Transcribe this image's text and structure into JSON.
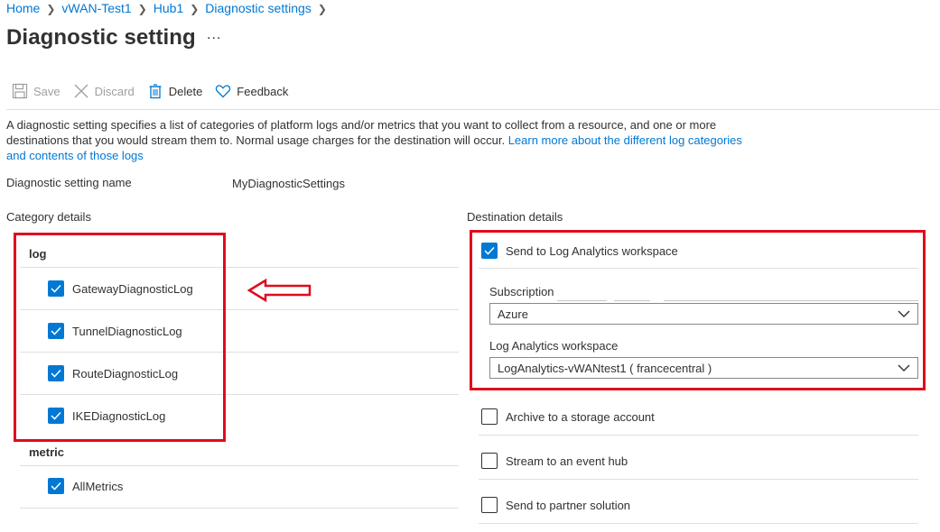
{
  "breadcrumb": [
    "Home",
    "vWAN-Test1",
    "Hub1",
    "Diagnostic settings"
  ],
  "page_title": "Diagnostic setting",
  "more_label": "...",
  "toolbar": {
    "save": "Save",
    "discard": "Discard",
    "delete": "Delete",
    "feedback": "Feedback"
  },
  "description": {
    "text": "A diagnostic setting specifies a list of categories of platform logs and/or metrics that you want to collect from a resource, and one or more destinations that you would stream them to. Normal usage charges for the destination will occur.",
    "link": "Learn more about the different log categories and contents of those logs"
  },
  "setting_name": {
    "label": "Diagnostic setting name",
    "value": "MyDiagnosticSettings"
  },
  "category_details": {
    "header": "Category details",
    "log_title": "log",
    "logs": [
      {
        "label": "GatewayDiagnosticLog",
        "checked": true
      },
      {
        "label": "TunnelDiagnosticLog",
        "checked": true
      },
      {
        "label": "RouteDiagnosticLog",
        "checked": true
      },
      {
        "label": "IKEDiagnosticLog",
        "checked": true
      }
    ],
    "metric_title": "metric",
    "metrics": [
      {
        "label": "AllMetrics",
        "checked": true
      }
    ]
  },
  "destination_details": {
    "header": "Destination details",
    "log_analytics": {
      "label": "Send to Log Analytics workspace",
      "checked": true
    },
    "subscription": {
      "label": "Subscription",
      "value": "Azure"
    },
    "workspace": {
      "label": "Log Analytics workspace",
      "value": "LogAnalytics-vWANtest1 ( francecentral )"
    },
    "others": [
      {
        "label": "Archive to a storage account",
        "checked": false
      },
      {
        "label": "Stream to an event hub",
        "checked": false
      },
      {
        "label": "Send to partner solution",
        "checked": false
      }
    ]
  },
  "colors": {
    "accent": "#0078d4",
    "highlight": "#e00b1c",
    "divider": "#e1dfdd"
  },
  "icons": [
    "save-icon",
    "discard-icon",
    "delete-icon",
    "feedback-icon",
    "checkmark-icon",
    "chevron-down-icon",
    "arrow-left-icon"
  ]
}
